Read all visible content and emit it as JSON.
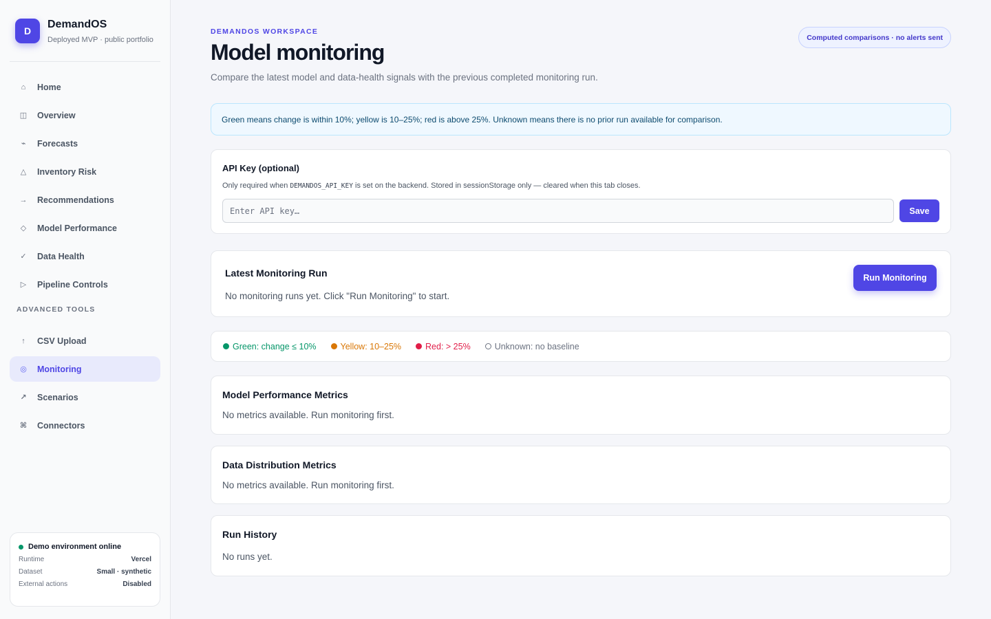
{
  "brand": {
    "logo_letter": "D",
    "name": "DemandOS",
    "subtitle": "Deployed MVP · public portfolio"
  },
  "sidebar": {
    "items": [
      {
        "label": "Home",
        "icon": "home-icon"
      },
      {
        "label": "Overview",
        "icon": "grid-icon"
      },
      {
        "label": "Forecasts",
        "icon": "trend-icon"
      },
      {
        "label": "Inventory Risk",
        "icon": "warning-triangle-icon"
      },
      {
        "label": "Recommendations",
        "icon": "arrow-right-icon"
      },
      {
        "label": "Model Performance",
        "icon": "diamond-icon"
      },
      {
        "label": "Data Health",
        "icon": "check-icon"
      },
      {
        "label": "Pipeline Controls",
        "icon": "play-icon"
      }
    ],
    "section_label": "ADVANCED TOOLS",
    "advanced_items": [
      {
        "label": "CSV Upload",
        "icon": "upload-arrow-icon"
      },
      {
        "label": "Monitoring",
        "icon": "monitoring-circle-icon",
        "active": true
      },
      {
        "label": "Scenarios",
        "icon": "diagonal-arrow-icon"
      },
      {
        "label": "Connectors",
        "icon": "command-icon"
      }
    ],
    "status": {
      "title": "Demo environment online",
      "rows": [
        {
          "key": "Runtime",
          "value": "Vercel"
        },
        {
          "key": "Dataset",
          "value": "Small · synthetic"
        },
        {
          "key": "External actions",
          "value": "Disabled"
        }
      ]
    }
  },
  "header": {
    "eyebrow": "DEMANDOS WORKSPACE",
    "title": "Model monitoring",
    "description": "Compare the latest model and data-health signals with the previous completed monitoring run.",
    "pill": "Computed comparisons · no alerts sent"
  },
  "info": {
    "text": "Green means change is within 10%; yellow is 10–25%; red is above 25%. Unknown means there is no prior run available for comparison."
  },
  "api_key": {
    "title": "API Key (optional)",
    "note_prefix": "Only required when",
    "note_code": "DEMANDOS_API_KEY",
    "note_suffix": "is set on the backend. Stored in sessionStorage only — cleared when this tab closes.",
    "placeholder": "Enter API key…",
    "value": "",
    "save_label": "Save"
  },
  "latest_run": {
    "title": "Latest Monitoring Run",
    "empty_text": "No monitoring runs yet. Click \"Run Monitoring\" to start.",
    "button_label": "Run Monitoring"
  },
  "legend": {
    "green": "Green: change ≤ 10%",
    "yellow": "Yellow: 10–25%",
    "red": "Red: > 25%",
    "unknown": "Unknown: no baseline"
  },
  "model_metrics": {
    "title": "Model Performance Metrics",
    "empty_text": "No metrics available. Run monitoring first."
  },
  "data_metrics": {
    "title": "Data Distribution Metrics",
    "empty_text": "No metrics available. Run monitoring first."
  },
  "run_history": {
    "title": "Run History",
    "empty_text": "No runs yet."
  },
  "colors": {
    "accent": "#4f46e5",
    "green": "#059669",
    "yellow": "#d97706",
    "red": "#e11d48"
  }
}
